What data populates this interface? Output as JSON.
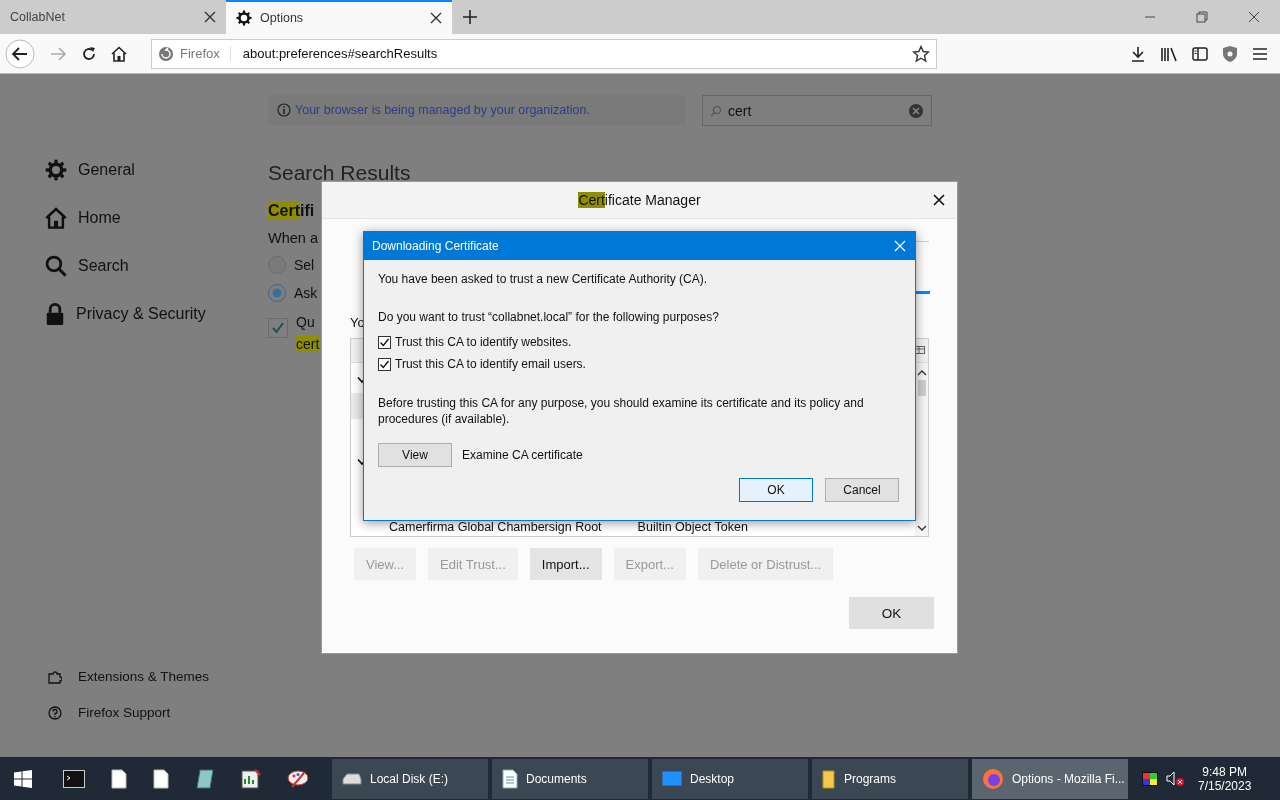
{
  "browser": {
    "tabs": [
      {
        "label": "CollabNet",
        "selected": false
      },
      {
        "label": "Options",
        "selected": true
      }
    ],
    "address": {
      "identity": "Firefox",
      "url": "about:preferences#searchResults"
    }
  },
  "page": {
    "notice": "Your browser is being managed by your organization.",
    "search": {
      "value": "cert"
    },
    "nav": [
      {
        "label": "General"
      },
      {
        "label": "Home"
      },
      {
        "label": "Search"
      },
      {
        "label": "Privacy & Security"
      }
    ],
    "footer_links": [
      {
        "label": "Extensions & Themes"
      },
      {
        "label": "Firefox Support"
      }
    ],
    "heading": "Search Results",
    "section": {
      "title_highlight": "Cert",
      "title_rest": "ifi",
      "description": "When a",
      "options": [
        {
          "kind": "radio",
          "label": "Sel",
          "selected": false
        },
        {
          "kind": "radio",
          "label": "Ask",
          "selected": true
        },
        {
          "kind": "checkbox",
          "label": "Qu",
          "checked": true,
          "continuation": "cert"
        }
      ]
    }
  },
  "certificate_manager": {
    "title_highlight": "Cert",
    "title_rest": "ificate Manager",
    "intro": "Yo",
    "rows": [
      {
        "name": "Camerfirma Global Chambersign Root",
        "token": "Builtin Object Token"
      }
    ],
    "buttons": [
      {
        "label": "View...",
        "disabled": true
      },
      {
        "label": "Edit Trust...",
        "disabled": true
      },
      {
        "label": "Import...",
        "disabled": false
      },
      {
        "label": "Export...",
        "disabled": true
      },
      {
        "label": "Delete or Distrust...",
        "disabled": true
      }
    ],
    "ok": "OK"
  },
  "download_dialog": {
    "title": "Downloading Certificate",
    "message": "You have been asked to trust a new Certificate Authority (CA).",
    "question": "Do you want to trust “collabnet.local” for the following purposes?",
    "purposes": [
      {
        "label": "Trust this CA to identify websites.",
        "checked": true
      },
      {
        "label": "Trust this CA to identify email users.",
        "checked": true
      }
    ],
    "advice": "Before trusting this CA for any purpose, you should examine its certificate and its policy and procedures (if available).",
    "view_button": "View",
    "view_label": "Examine CA certificate",
    "ok": "OK",
    "cancel": "Cancel"
  },
  "taskbar": {
    "tasks": [
      {
        "label": "Local Disk (E:)",
        "selected": false
      },
      {
        "label": "Documents",
        "selected": false
      },
      {
        "label": "Desktop",
        "selected": false
      },
      {
        "label": "Programs",
        "selected": false
      },
      {
        "label": "Options - Mozilla Fi...",
        "selected": true
      }
    ],
    "time": "9:48 PM",
    "date": "7/15/2023"
  }
}
